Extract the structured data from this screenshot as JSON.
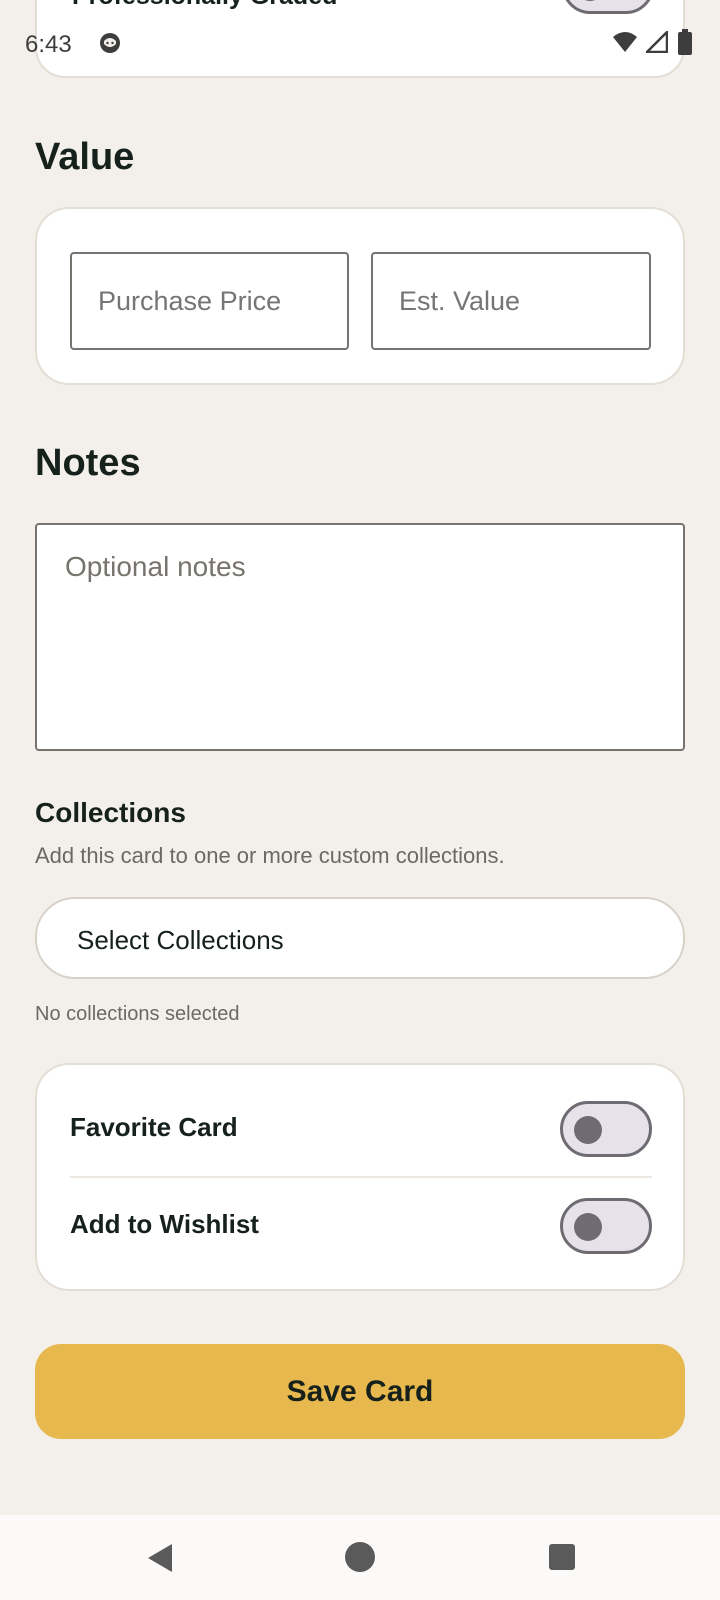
{
  "status_bar": {
    "time": "6:43"
  },
  "graded_card": {
    "label": "Professionally Graded",
    "toggle_on": false
  },
  "value_section": {
    "title": "Value",
    "purchase_price_placeholder": "Purchase Price",
    "est_value_placeholder": "Est. Value"
  },
  "notes_section": {
    "title": "Notes",
    "placeholder": "Optional notes"
  },
  "collections_section": {
    "title": "Collections",
    "description": "Add this card to one or more custom collections.",
    "select_label": "Select Collections",
    "status": "No collections selected"
  },
  "flags": {
    "favorite_label": "Favorite Card",
    "favorite_on": false,
    "wishlist_label": "Add to Wishlist",
    "wishlist_on": false
  },
  "save_button": "Save Card",
  "colors": {
    "background": "#f3f0eb",
    "accent": "#e6b84e",
    "text": "#16211b"
  }
}
